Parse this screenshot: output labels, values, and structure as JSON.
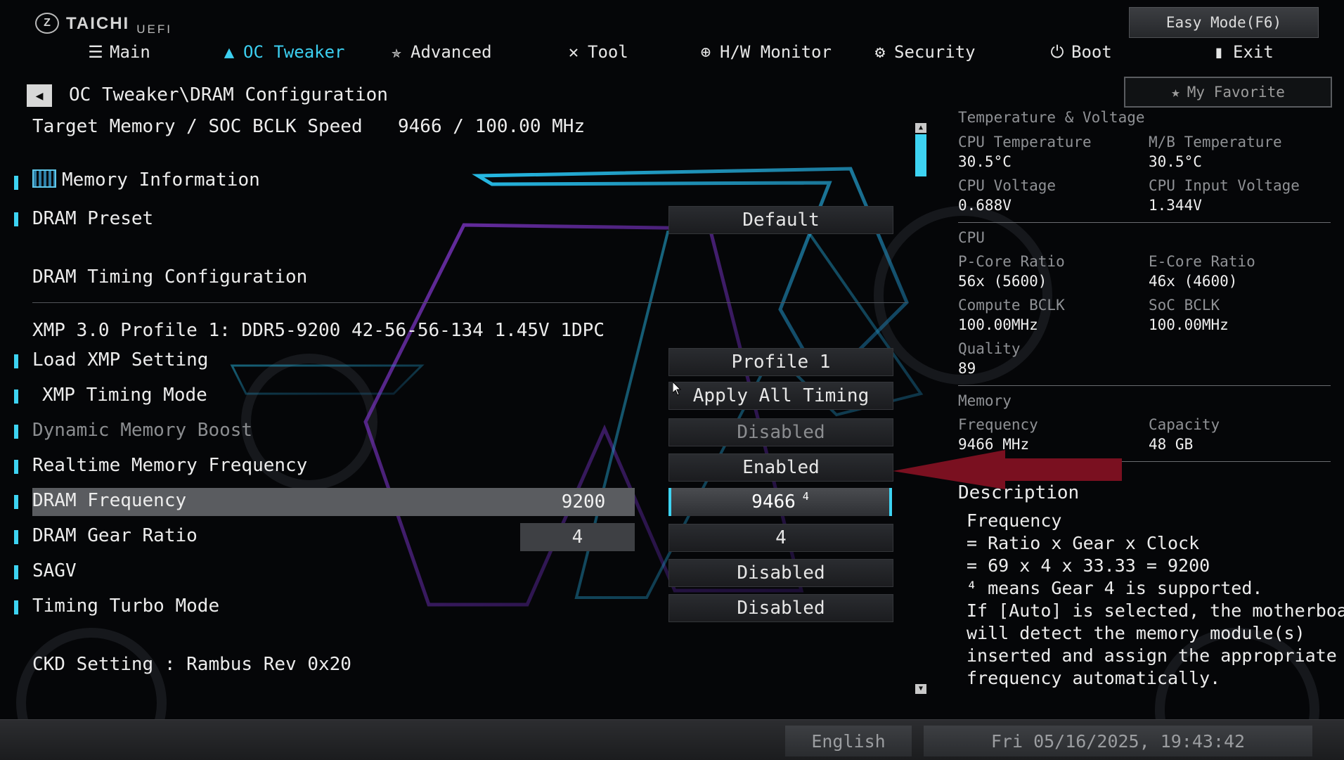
{
  "brand": {
    "name": "TAICHI",
    "sub": "UEFI",
    "mark": "Z"
  },
  "header": {
    "easy_mode": "Easy Mode(F6)",
    "my_favorite": "My Favorite"
  },
  "nav": [
    {
      "label": "Main",
      "icon": "list-icon"
    },
    {
      "label": "OC Tweaker",
      "icon": "rocket-icon",
      "active": true
    },
    {
      "label": "Advanced",
      "icon": "star-icon"
    },
    {
      "label": "Tool",
      "icon": "tools-icon"
    },
    {
      "label": "H/W Monitor",
      "icon": "crosshair-icon"
    },
    {
      "label": "Security",
      "icon": "shield-icon"
    },
    {
      "label": "Boot",
      "icon": "power-icon"
    },
    {
      "label": "Exit",
      "icon": "exit-icon"
    }
  ],
  "breadcrumb": "OC Tweaker\\DRAM Configuration",
  "target": {
    "label": "Target Memory / SOC BCLK Speed",
    "value": "9466 / 100.00 MHz"
  },
  "rows": {
    "memory_information": "Memory Information",
    "dram_preset": {
      "label": "DRAM Preset",
      "value": "Default"
    },
    "dram_timing_config": "DRAM Timing Configuration",
    "xmp_profile": "XMP 3.0 Profile 1: DDR5-9200 42-56-56-134 1.45V 1DPC",
    "load_xmp": {
      "label": "Load XMP Setting",
      "value": "Profile 1"
    },
    "xmp_timing_mode": {
      "label": "XMP Timing Mode",
      "value": "Apply All Timing"
    },
    "dynamic_memory_boost": {
      "label": "Dynamic Memory Boost",
      "value": "Disabled"
    },
    "realtime_memory_freq": {
      "label": "Realtime Memory Frequency",
      "value": "Enabled"
    },
    "dram_frequency": {
      "label": "DRAM Frequency",
      "current": "9200",
      "value": "9466",
      "superscript": "4"
    },
    "dram_gear_ratio": {
      "label": "DRAM Gear Ratio",
      "current": "4",
      "value": "4"
    },
    "sagv": {
      "label": "SAGV",
      "value": "Disabled"
    },
    "timing_turbo": {
      "label": "Timing Turbo Mode",
      "value": "Disabled"
    },
    "ckd_setting": "CKD Setting : Rambus Rev 0x20"
  },
  "monitor": {
    "section_temp": "Temperature & Voltage",
    "cpu_temp": {
      "label": "CPU Temperature",
      "value": "30.5°C"
    },
    "mb_temp": {
      "label": "M/B Temperature",
      "value": "30.5°C"
    },
    "cpu_voltage": {
      "label": "CPU Voltage",
      "value": "0.688V"
    },
    "cpu_input_voltage": {
      "label": "CPU Input Voltage",
      "value": "1.344V"
    },
    "section_cpu": "CPU",
    "pcore": {
      "label": "P-Core Ratio",
      "value": "56x (5600)"
    },
    "ecore": {
      "label": "E-Core Ratio",
      "value": "46x (4600)"
    },
    "compute_bclk": {
      "label": "Compute BCLK",
      "value": "100.00MHz"
    },
    "soc_bclk": {
      "label": "SoC BCLK",
      "value": "100.00MHz"
    },
    "quality": {
      "label": "Quality",
      "value": "89"
    },
    "section_memory": "Memory",
    "frequency": {
      "label": "Frequency",
      "value": "9466 MHz"
    },
    "capacity": {
      "label": "Capacity",
      "value": "48 GB"
    }
  },
  "description": {
    "title": "Description",
    "lines": [
      "Frequency",
      "= Ratio x Gear x Clock",
      "= 69 x 4 x 33.33 = 9200",
      "⁴ means Gear 4 is supported.",
      "If [Auto] is selected, the motherboard",
      "will detect the memory module(s)",
      "inserted and assign the appropriate",
      "frequency automatically."
    ]
  },
  "footer": {
    "language": "English",
    "datetime": "Fri 05/16/2025, 19:43:42"
  },
  "colors": {
    "accent": "#3dd3f2",
    "arrow": "#7a1020",
    "background": "#050608"
  }
}
